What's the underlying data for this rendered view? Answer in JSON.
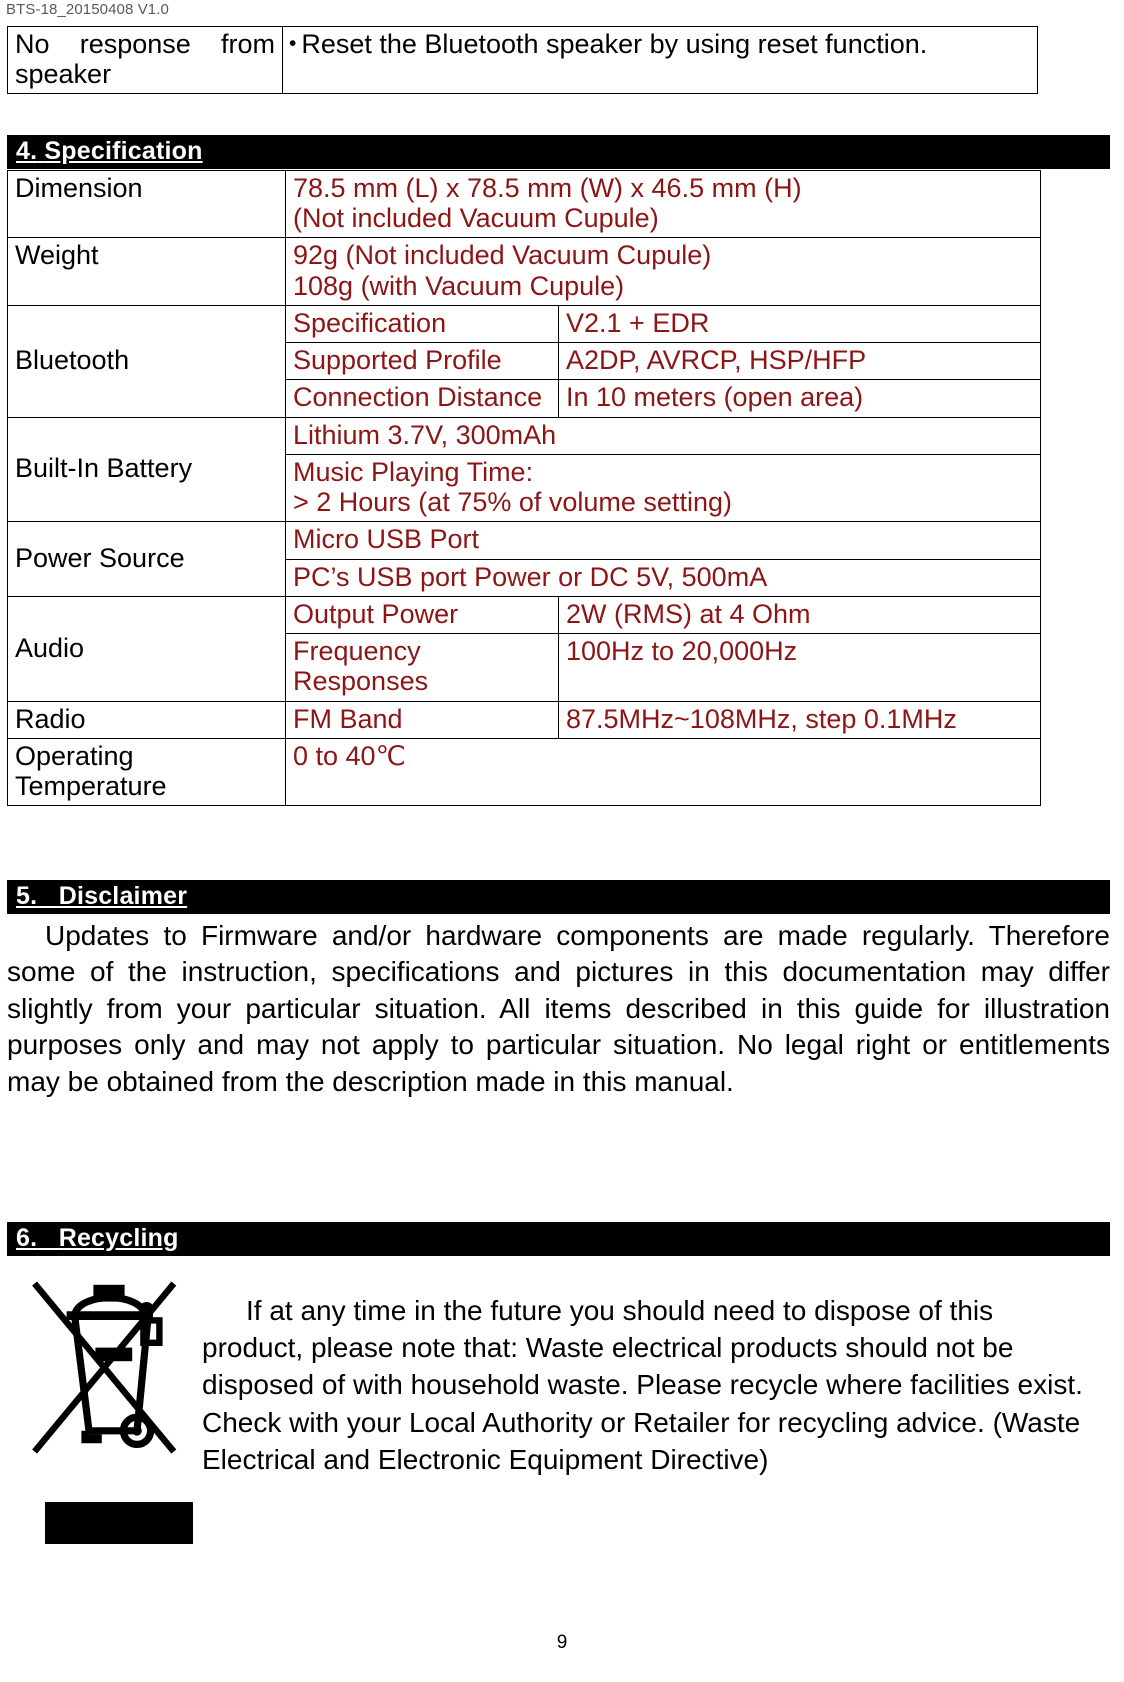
{
  "document": {
    "header": "BTS-18_20150408 V1.0",
    "page_number": "9"
  },
  "troubleshooting": {
    "symptom": "No response from speaker",
    "bullet_glyph": "•",
    "solution": "Reset the Bluetooth speaker by using reset function."
  },
  "specification": {
    "heading_number": "4.",
    "heading_title": "Specification",
    "rows": {
      "dimension": {
        "label": "Dimension",
        "line1": "78.5 mm (L) x 78.5 mm (W) x 46.5 mm (H)",
        "line2": "(Not included Vacuum Cupule)"
      },
      "weight": {
        "label": "Weight",
        "line1": "92g (Not included Vacuum Cupule)",
        "line2": "108g (with Vacuum Cupule)"
      },
      "bluetooth": {
        "label": "Bluetooth",
        "spec_key": "Specification",
        "spec_val": "V2.1 + EDR",
        "profile_key": "Supported Profile",
        "profile_val": "A2DP, AVRCP, HSP/HFP",
        "distance_key": "Connection Distance",
        "distance_val": "In 10 meters (open area)"
      },
      "battery": {
        "label": "Built-In Battery",
        "line1": "Lithium 3.7V, 300mAh",
        "line2": "Music Playing Time:",
        "line3": "> 2 Hours (at 75% of volume setting)"
      },
      "power": {
        "label": "Power Source",
        "line1": "Micro USB Port",
        "line2": "PC’s USB port Power or DC 5V, 500mA"
      },
      "audio": {
        "label": "Audio",
        "output_key": "Output Power",
        "output_val": "2W (RMS) at 4 Ohm",
        "freq_key": "Frequency Responses",
        "freq_val": "100Hz to 20,000Hz"
      },
      "radio": {
        "label": "Radio",
        "key": "FM Band",
        "val": "87.5MHz~108MHz, step 0.1MHz"
      },
      "temperature": {
        "label": "Operating Temperature",
        "val": "0  to 40℃"
      }
    }
  },
  "disclaimer": {
    "heading_number": "5.",
    "heading_title": "Disclaimer",
    "body": "Updates to Firmware and/or hardware components are made regularly. Therefore some of the instruction, specifications and pictures in this documentation may differ slightly from your particular situation. All items described in this guide for illustration purposes only and may not apply to particular situation. No legal right or entitlements may be obtained from the description made in this manual."
  },
  "recycling": {
    "heading_number": "6.",
    "heading_title": "Recycling",
    "body": "If at any time in the future you should need to dispose of this product, please note that: Waste electrical products should not be disposed of with household waste. Please recycle where facilities exist. Check with your Local Authority or Retailer for recycling advice. (Waste Electrical and Electronic Equipment Directive)",
    "icon_name": "weee-crossed-out-wheelie-bin-icon"
  },
  "colors": {
    "spec_value_red": "#8C1616",
    "section_bar_bg": "#000000",
    "section_bar_text": "#FFFFFF",
    "header_gray": "#595959"
  }
}
